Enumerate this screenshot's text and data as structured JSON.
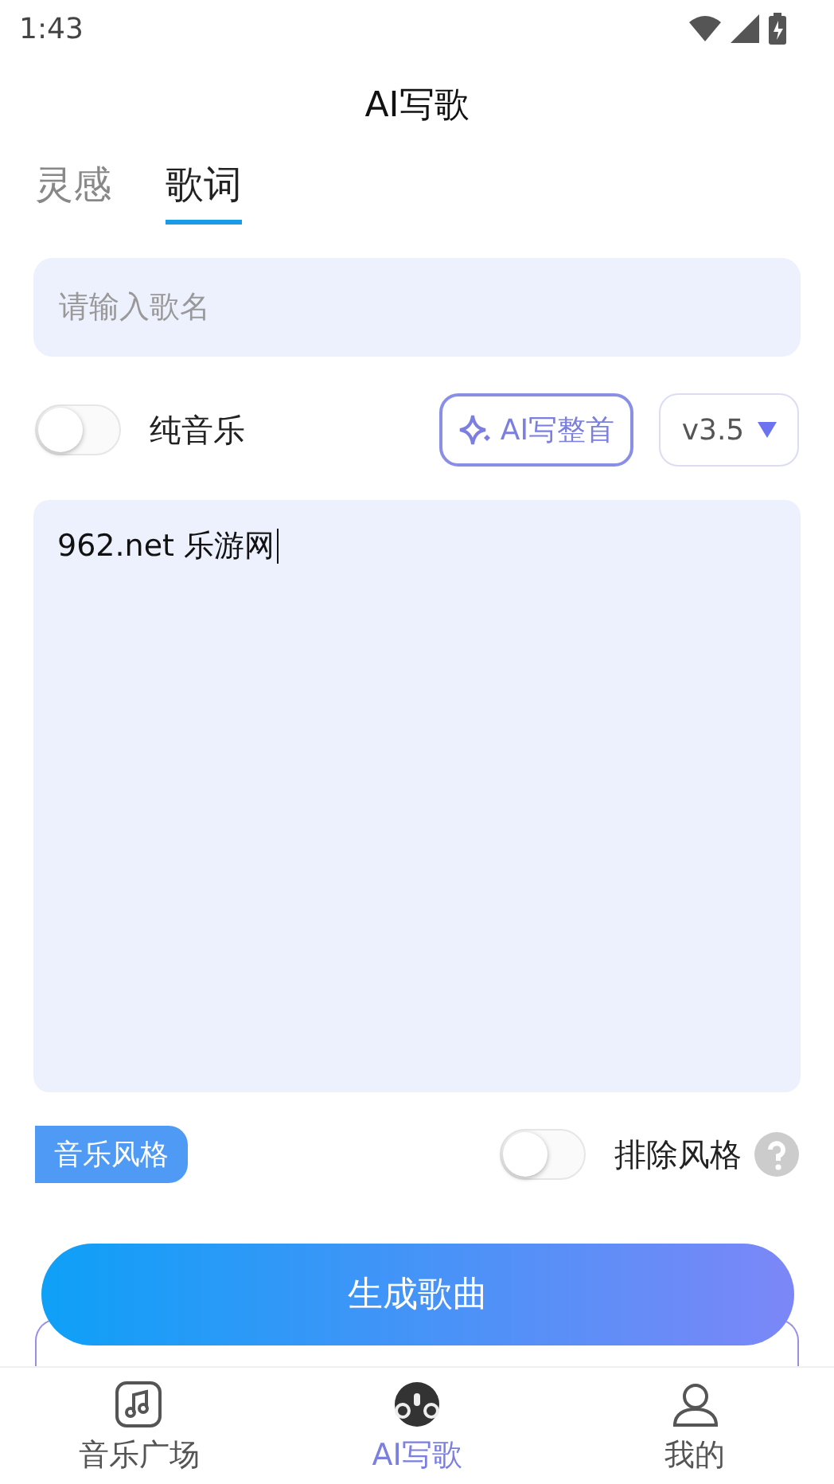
{
  "status_bar": {
    "time": "1:43"
  },
  "header": {
    "title": "AI写歌"
  },
  "tabs": [
    {
      "label": "灵感",
      "selected": false
    },
    {
      "label": "歌词",
      "selected": true
    }
  ],
  "song_name": {
    "placeholder": "请输入歌名"
  },
  "options_row": {
    "pure_music": {
      "label": "纯音乐",
      "on": false
    },
    "write_button": "AI写整首",
    "version": "v3.5"
  },
  "lyrics": {
    "value": "962.net 乐游网"
  },
  "style": {
    "tag": "音乐风格",
    "exclude": {
      "label": "排除风格",
      "on": false
    }
  },
  "generate_button": "生成歌曲",
  "nav": [
    {
      "label": "音乐广场",
      "selected": false
    },
    {
      "label": "AI写歌",
      "selected": true
    },
    {
      "label": "我的",
      "selected": false
    }
  ]
}
